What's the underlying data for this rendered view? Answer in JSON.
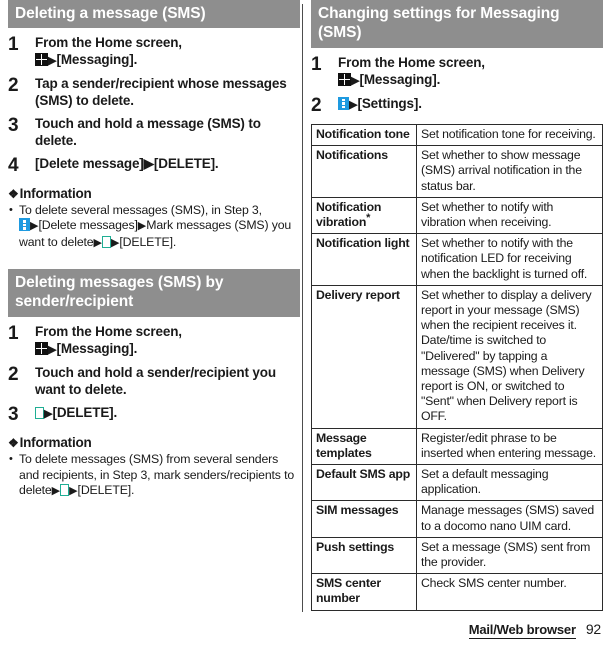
{
  "footer": {
    "label": "Mail/Web browser",
    "page": "92"
  },
  "icons": {
    "app_drawer": "grid-icon",
    "overflow_menu": "vertical-dots-icon",
    "delete": "trash-icon",
    "arrow": "▶",
    "floret": "❖"
  },
  "left_column": {
    "section1": {
      "title": "Deleting a message (SMS)",
      "steps": [
        {
          "num": "1",
          "text_before": "From the Home screen,",
          "text_after": "[Messaging]."
        },
        {
          "num": "2",
          "text": "Tap a sender/recipient whose messages (SMS) to delete."
        },
        {
          "num": "3",
          "text": "Touch and hold a message (SMS) to delete."
        },
        {
          "num": "4",
          "text": "[Delete message]▶[DELETE]."
        }
      ],
      "information": {
        "heading": "Information",
        "items": [
          {
            "p1": "To delete several messages (SMS), in Step 3,",
            "p2": "[Delete messages]",
            "p3": "Mark messages (SMS) you want to delete",
            "p4": "[DELETE]."
          }
        ]
      }
    },
    "section2": {
      "title": "Deleting messages (SMS) by sender/recipient",
      "steps": [
        {
          "num": "1",
          "text_before": "From the Home screen,",
          "text_after": "[Messaging]."
        },
        {
          "num": "2",
          "text": "Touch and hold a sender/recipient you want to delete."
        },
        {
          "num": "3",
          "text_after": "[DELETE]."
        }
      ],
      "information": {
        "heading": "Information",
        "items": [
          {
            "p1": "To delete messages (SMS) from several senders and recipients, in Step 3, mark senders/recipients to delete",
            "p2": "[DELETE]."
          }
        ]
      }
    }
  },
  "right_column": {
    "section": {
      "title": "Changing settings for Messaging (SMS)",
      "steps": [
        {
          "num": "1",
          "text_before": "From the Home screen,",
          "text_after": "[Messaging]."
        },
        {
          "num": "2",
          "text_after": "[Settings]."
        }
      ]
    },
    "settings_table": {
      "rows": [
        {
          "name": "Notification tone",
          "has_asterisk": false,
          "desc": "Set notification tone for receiving."
        },
        {
          "name": "Notifications",
          "has_asterisk": false,
          "desc": "Set whether to show message (SMS) arrival notification in the status bar."
        },
        {
          "name": "Notification vibration",
          "has_asterisk": true,
          "desc": "Set whether to notify with vibration when receiving."
        },
        {
          "name": "Notification light",
          "has_asterisk": false,
          "desc": "Set whether to notify with the notification LED for receiving when the backlight is turned off."
        },
        {
          "name": "Delivery report",
          "has_asterisk": false,
          "desc": "Set whether to display a delivery report in your message (SMS) when the recipient receives it.\nDate/time is switched to \"Delivered\" by tapping a message (SMS) when Delivery report is ON, or switched to \"Sent\" when Delivery report is OFF."
        },
        {
          "name": "Message templates",
          "has_asterisk": false,
          "desc": "Register/edit phrase to be inserted when entering message."
        },
        {
          "name": "Default SMS app",
          "has_asterisk": false,
          "desc": "Set a default messaging application."
        },
        {
          "name": "SIM messages",
          "has_asterisk": false,
          "desc": "Manage messages (SMS) saved to a docomo nano UIM card."
        },
        {
          "name": "Push settings",
          "has_asterisk": false,
          "desc": "Set a message (SMS) sent from the provider."
        },
        {
          "name": "SMS center number",
          "has_asterisk": false,
          "desc": "Check SMS center number."
        }
      ]
    }
  },
  "colors": {
    "header_band": "#8e8e8e",
    "icon_blue": "#1e9ae0",
    "icon_teal": "#1fae94",
    "text": "#1a1a1a"
  }
}
